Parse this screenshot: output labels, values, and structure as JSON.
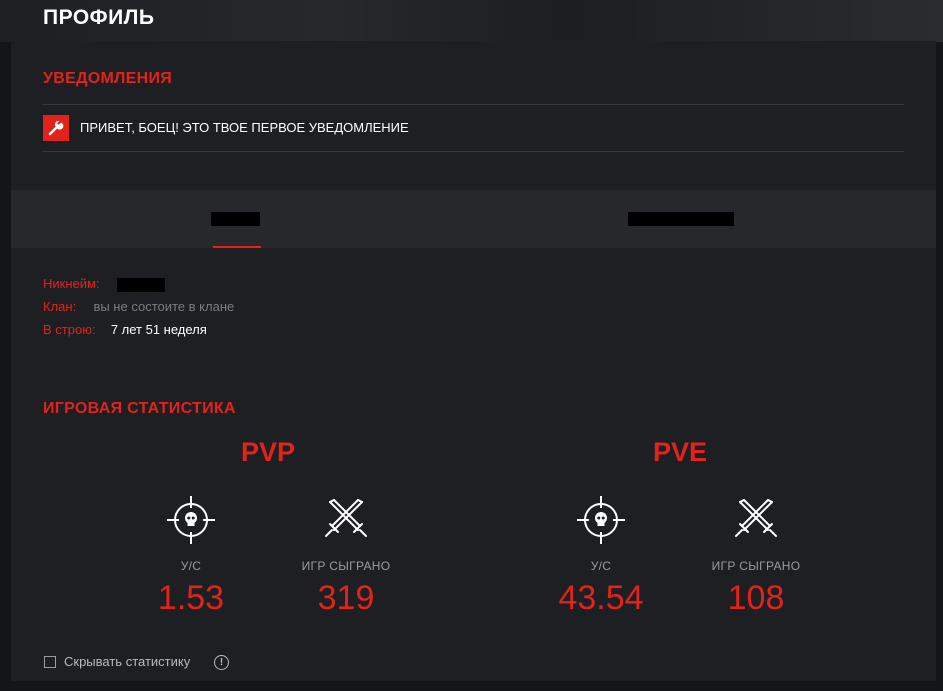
{
  "page": {
    "title": "ПРОФИЛЬ"
  },
  "notifications": {
    "title": "УВЕДОМЛЕНИЯ",
    "items": [
      {
        "icon": "wrench-icon",
        "text": "ПРИВЕТ, БОЕЦ! ЭТО ТВОЕ ПЕРВОЕ УВЕДОМЛЕНИЕ"
      }
    ]
  },
  "tabs": {
    "active_index": 0
  },
  "profile": {
    "nickname_label": "Никнейм:",
    "clan_label": "Клан:",
    "clan_value": "вы не состоите в клане",
    "service_label": "В строю:",
    "service_value": "7 лет 51 неделя"
  },
  "stats": {
    "title": "ИГРОВАЯ СТАТИСТИКА",
    "pvp": {
      "title": "PVP",
      "kd_label": "У/С",
      "kd_value": "1.53",
      "games_label": "ИГР СЫГРАНО",
      "games_value": "319"
    },
    "pve": {
      "title": "PVE",
      "kd_label": "У/С",
      "kd_value": "43.54",
      "games_label": "ИГР СЫГРАНО",
      "games_value": "108"
    }
  },
  "settings": {
    "hide_stats_label": "Скрывать статистику",
    "hide_stats_checked": false
  },
  "colors": {
    "accent": "#e1231b",
    "panel": "#1e1f23",
    "tabs": "#27282c"
  }
}
